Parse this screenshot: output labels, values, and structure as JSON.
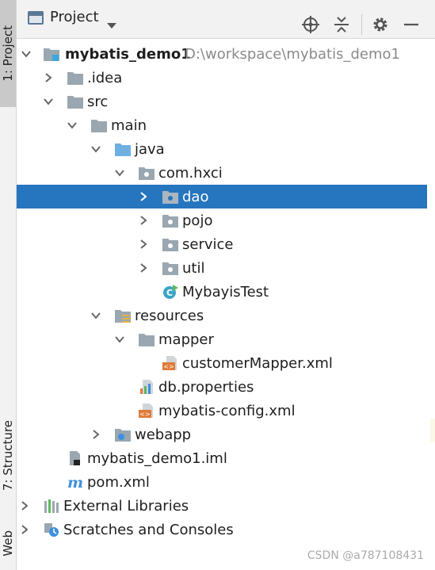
{
  "side_tabs": {
    "project": "1: Project",
    "structure": "7: Structure",
    "web": "Web"
  },
  "header": {
    "title": "Project",
    "icons": [
      "window-icon",
      "caret-down-icon",
      "locate-icon",
      "collapse-icon",
      "gear-icon",
      "minimize-icon"
    ]
  },
  "tree": {
    "root": {
      "name": "mybatis_demo1",
      "path": "D:\\workspace\\mybatis_demo1"
    },
    "idea": ".idea",
    "src": "src",
    "main": "main",
    "java": "java",
    "package": "com.hxci",
    "dao": "dao",
    "pojo": "pojo",
    "service": "service",
    "util": "util",
    "test_class": "MybayisTest",
    "resources": "resources",
    "mapper": "mapper",
    "mapper_xml": "customerMapper.xml",
    "db_properties": "db.properties",
    "config_xml": "mybatis-config.xml",
    "webapp": "webapp",
    "iml": "mybatis_demo1.iml",
    "pom": "pom.xml",
    "external_libraries": "External Libraries",
    "scratches": "Scratches and Consoles"
  },
  "selected_item": "dao",
  "colors": {
    "selection": "#2675bf",
    "folder": "#9aa7b0",
    "source_folder": "#6fb0e0",
    "xml_icon": "#e07b39",
    "maven": "#3d8fe0"
  },
  "watermark": "CSDN @a787108431"
}
